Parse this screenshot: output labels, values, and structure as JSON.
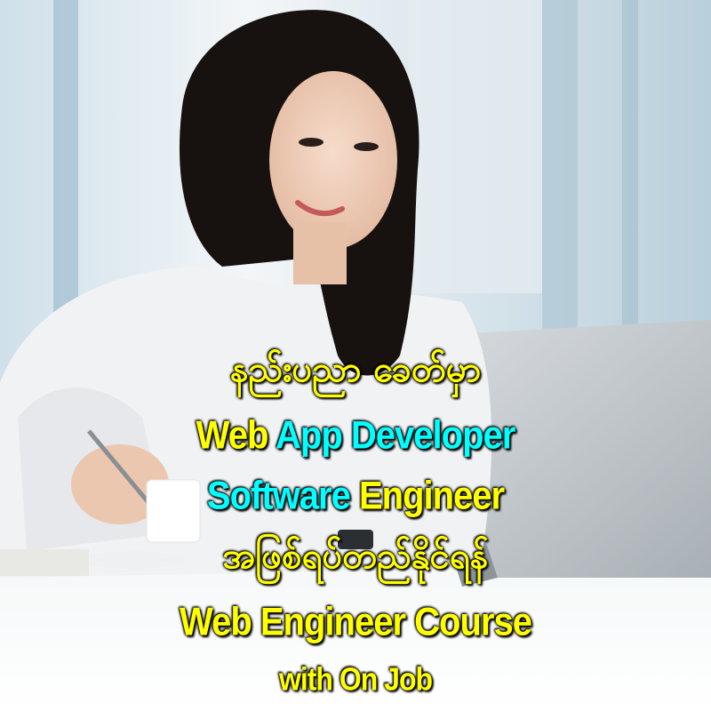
{
  "colors": {
    "yellow": "#ffff00",
    "cyan": "#00ffff",
    "outline": "#000000"
  },
  "headline": {
    "line1": "နည်းပညာ ခေတ်မှာ",
    "line2": {
      "part1": "Web",
      "part2": "App Developer"
    },
    "line3": {
      "part1": "Software",
      "part2": "Engineer"
    },
    "line4": "အဖြစ်ရပ်တည်နိုင်ရန်",
    "line5": "Web Engineer Course",
    "line6": "with On Job"
  }
}
